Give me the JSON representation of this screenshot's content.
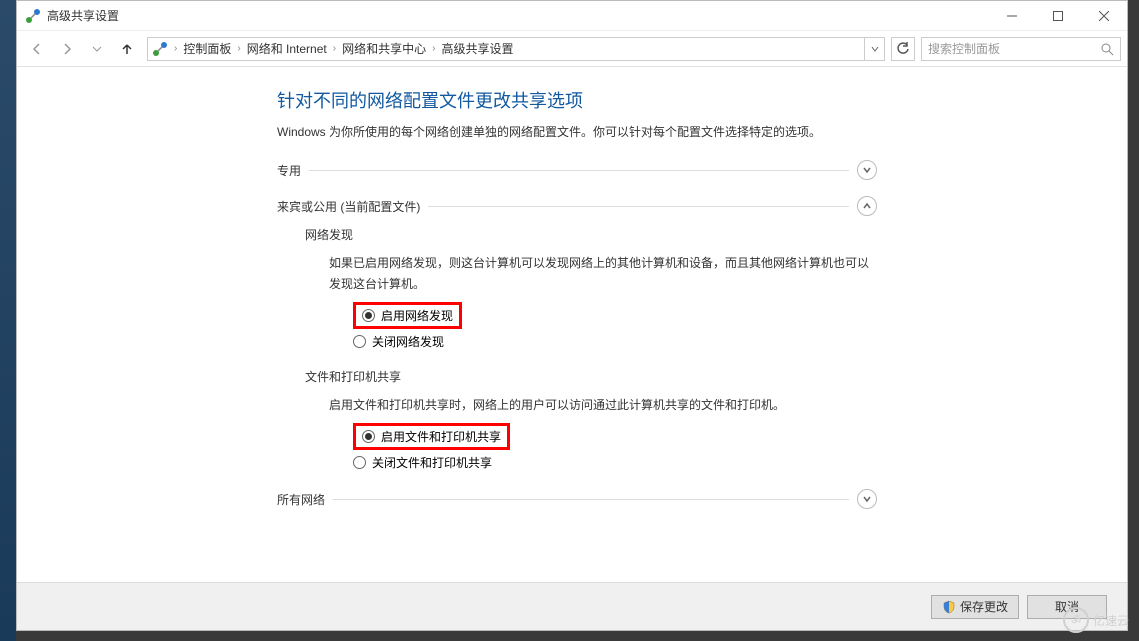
{
  "window": {
    "title": "高级共享设置"
  },
  "nav": {
    "breadcrumbs": [
      "控制面板",
      "网络和 Internet",
      "网络和共享中心",
      "高级共享设置"
    ],
    "search_placeholder": "搜索控制面板"
  },
  "page": {
    "title": "针对不同的网络配置文件更改共享选项",
    "description": "Windows 为你所使用的每个网络创建单独的网络配置文件。你可以针对每个配置文件选择特定的选项。"
  },
  "sections": {
    "private": {
      "label": "专用"
    },
    "guest": {
      "label": "来宾或公用 (当前配置文件)"
    },
    "all": {
      "label": "所有网络"
    }
  },
  "discovery": {
    "title": "网络发现",
    "description": "如果已启用网络发现，则这台计算机可以发现网络上的其他计算机和设备，而且其他网络计算机也可以发现这台计算机。",
    "opt_on": "启用网络发现",
    "opt_off": "关闭网络发现"
  },
  "fileshare": {
    "title": "文件和打印机共享",
    "description": "启用文件和打印机共享时，网络上的用户可以访问通过此计算机共享的文件和打印机。",
    "opt_on": "启用文件和打印机共享",
    "opt_off": "关闭文件和打印机共享"
  },
  "footer": {
    "save": "保存更改",
    "cancel": "取消"
  },
  "watermark": {
    "text": "亿速云",
    "icon": "ॐ"
  }
}
